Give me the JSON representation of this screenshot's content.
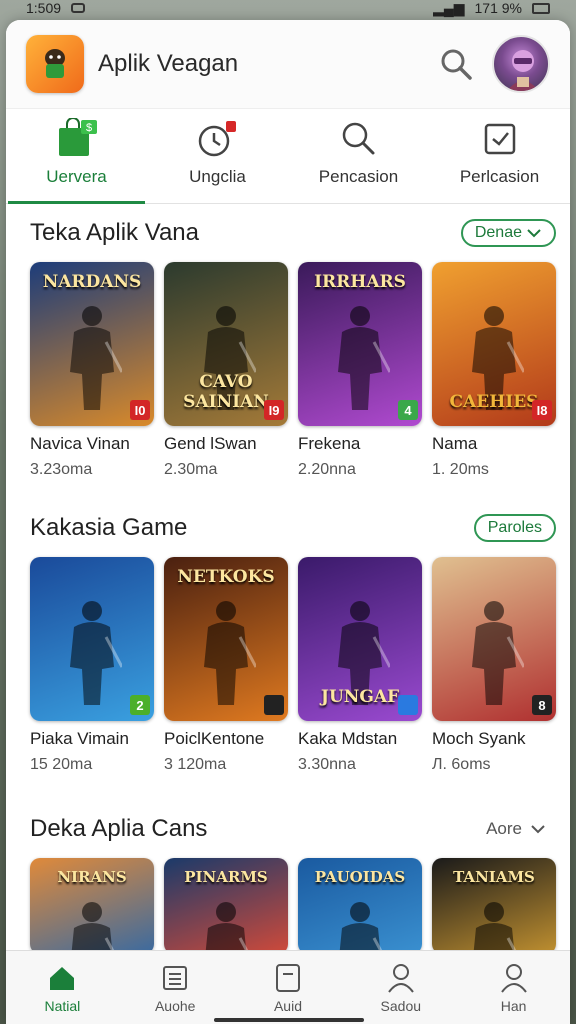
{
  "status_bar": {
    "time": "1:509",
    "battery": "171 9%"
  },
  "app": {
    "title": "Aplik Veagan",
    "logo_icon": "android-icon"
  },
  "tabs": [
    {
      "label": "Uervera",
      "icon": "shop-bag-icon",
      "active": true
    },
    {
      "label": "Ungclia",
      "icon": "clock-icon",
      "active": false
    },
    {
      "label": "Pencasion",
      "icon": "search-icon",
      "active": false
    },
    {
      "label": "Perlcasion",
      "icon": "checkbox-icon",
      "active": false
    }
  ],
  "sections": [
    {
      "title": "Teka Aplik Vana",
      "action": "Denae",
      "cards": [
        {
          "name": "Navica Vinan",
          "size": "3.23oma",
          "thumb_title": "NARDANS",
          "badge": "I0",
          "badge_color": "#d32626",
          "bg": [
            "#1c3c7a",
            "#d98a2a"
          ]
        },
        {
          "name": "Gend lSwan",
          "size": "2.30ma",
          "thumb_title": "CAVO SAINIAN",
          "badge": "I9",
          "badge_color": "#d32626",
          "bg": [
            "#2b3a2e",
            "#a47a38"
          ]
        },
        {
          "name": "Frekena",
          "size": "2.20nna",
          "thumb_title": "IRRHARS",
          "badge": "4",
          "badge_color": "#3aa84a",
          "bg": [
            "#3a1a5a",
            "#b04ad0"
          ]
        },
        {
          "name": "Nama",
          "size": "1. 20ms",
          "thumb_title": "CAEHIES",
          "badge": "I8",
          "badge_color": "#d32626",
          "bg": [
            "#f0a030",
            "#b23a1a"
          ]
        }
      ]
    },
    {
      "title": "Kakasia Game",
      "action": "Paroles",
      "cards": [
        {
          "name": "Piaka Vimain",
          "size": "15 20ma",
          "thumb_title": "",
          "badge": "2",
          "badge_color": "#4caf2a",
          "bg": [
            "#1a4a9a",
            "#3aa0e0"
          ]
        },
        {
          "name": "PoiclKentone",
          "size": "3 120ma",
          "thumb_title": "NETKOKS",
          "badge": "",
          "badge_color": "#222",
          "bg": [
            "#4a2010",
            "#e07a20"
          ]
        },
        {
          "name": "Kaka Mdstan",
          "size": "3.30nna",
          "thumb_title": "JUNGAF",
          "badge": "",
          "badge_color": "#2a7ae0",
          "bg": [
            "#3a1a6a",
            "#9a4ad0"
          ]
        },
        {
          "name": "Moch Syank",
          "size": "Л. 6oms",
          "thumb_title": "",
          "badge": "8",
          "badge_color": "#222",
          "bg": [
            "#e0c090",
            "#b03030"
          ]
        }
      ]
    },
    {
      "title": "Deka Aplia Cans",
      "action": "Aore",
      "cards": [
        {
          "thumb_title": "NIRANS",
          "bg": [
            "#e08a3a",
            "#3a6aa0"
          ]
        },
        {
          "thumb_title": "PINARMS",
          "bg": [
            "#1a3a6a",
            "#d04a3a"
          ]
        },
        {
          "thumb_title": "PAUOIDAS",
          "bg": [
            "#1a5aa0",
            "#3a90d0"
          ]
        },
        {
          "thumb_title": "TANIAMS",
          "bg": [
            "#1a1a1a",
            "#c09030"
          ]
        }
      ]
    }
  ],
  "bottom_nav": [
    {
      "label": "Natial",
      "icon": "home-icon",
      "active": true
    },
    {
      "label": "Auohe",
      "icon": "list-icon",
      "active": false
    },
    {
      "label": "Auid",
      "icon": "tablet-icon",
      "active": false
    },
    {
      "label": "Sadou",
      "icon": "person-icon",
      "active": false
    },
    {
      "label": "Han",
      "icon": "person-icon",
      "active": false
    }
  ]
}
